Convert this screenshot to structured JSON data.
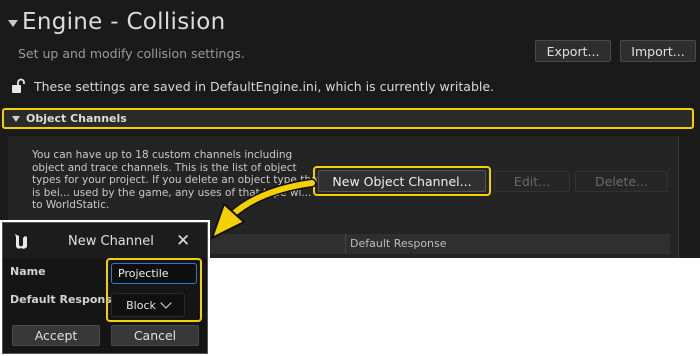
{
  "header": {
    "title": "Engine - Collision",
    "subtitle": "Set up and modify collision settings.",
    "export_label": "Export...",
    "import_label": "Import...",
    "notice": "These settings are saved in DefaultEngine.ini, which is currently writable."
  },
  "section": {
    "label": "Object Channels",
    "description": "You can have up to 18 custom channels including object and trace channels. This is the list of object types for your project. If you delete an object type that is bei... used by the game, any uses of that type wi... to WorldStatic.",
    "new_channel_label": "New Object Channel...",
    "edit_label": "Edit...",
    "delete_label": "Delete...",
    "column_default_response": "Default Response"
  },
  "dialog": {
    "title": "New Channel",
    "close_glyph": "✕",
    "name_label": "Name",
    "name_value": "Projectile",
    "response_label": "Default Response",
    "response_value": "Block",
    "accept_label": "Accept",
    "cancel_label": "Cancel"
  },
  "colors": {
    "highlight": "#f5d000",
    "panel_bg": "#1a1a1a",
    "input_focus": "#2b7ad6"
  },
  "icons": [
    "lock-open-icon",
    "unreal-logo-icon",
    "close-icon",
    "chevron-down-icon",
    "caret-down-icon",
    "arrow-annotation"
  ]
}
